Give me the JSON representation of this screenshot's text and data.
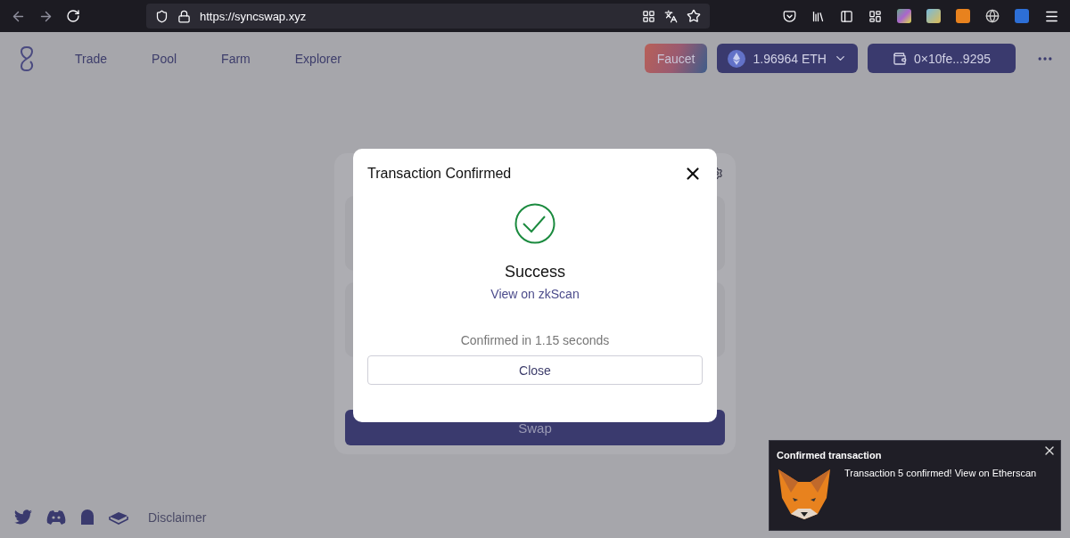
{
  "browser": {
    "url": "https://syncswap.xyz"
  },
  "nav": {
    "items": [
      {
        "label": "Trade"
      },
      {
        "label": "Pool"
      },
      {
        "label": "Farm"
      },
      {
        "label": "Explorer"
      }
    ]
  },
  "header": {
    "faucet": "Faucet",
    "balance": "1.96964 ETH",
    "account": "0×10fe...9295"
  },
  "swap_card": {
    "button": "Swap"
  },
  "footer": {
    "link": "Disclaimer"
  },
  "modal": {
    "title": "Transaction Confirmed",
    "status": "Success",
    "link": "View on zkScan",
    "note": "Confirmed in 1.15 seconds",
    "button": "Close"
  },
  "notification": {
    "title": "Confirmed transaction",
    "message": "Transaction 5 confirmed! View on Etherscan"
  }
}
